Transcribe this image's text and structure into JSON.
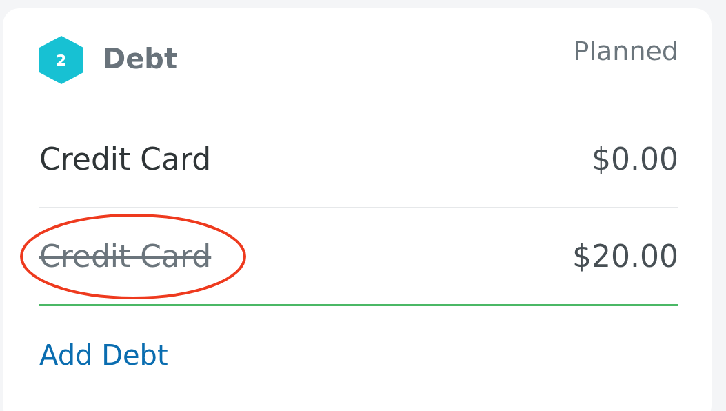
{
  "group": {
    "number": "2",
    "title": "Debt",
    "column_heading": "Planned"
  },
  "items": [
    {
      "name": "Credit Card",
      "amount": "$0.00",
      "struck": false,
      "circled": false,
      "funded": false
    },
    {
      "name": "Credit Card",
      "amount": "$20.00",
      "struck": true,
      "circled": true,
      "funded": true
    }
  ],
  "add_link": "Add Debt"
}
